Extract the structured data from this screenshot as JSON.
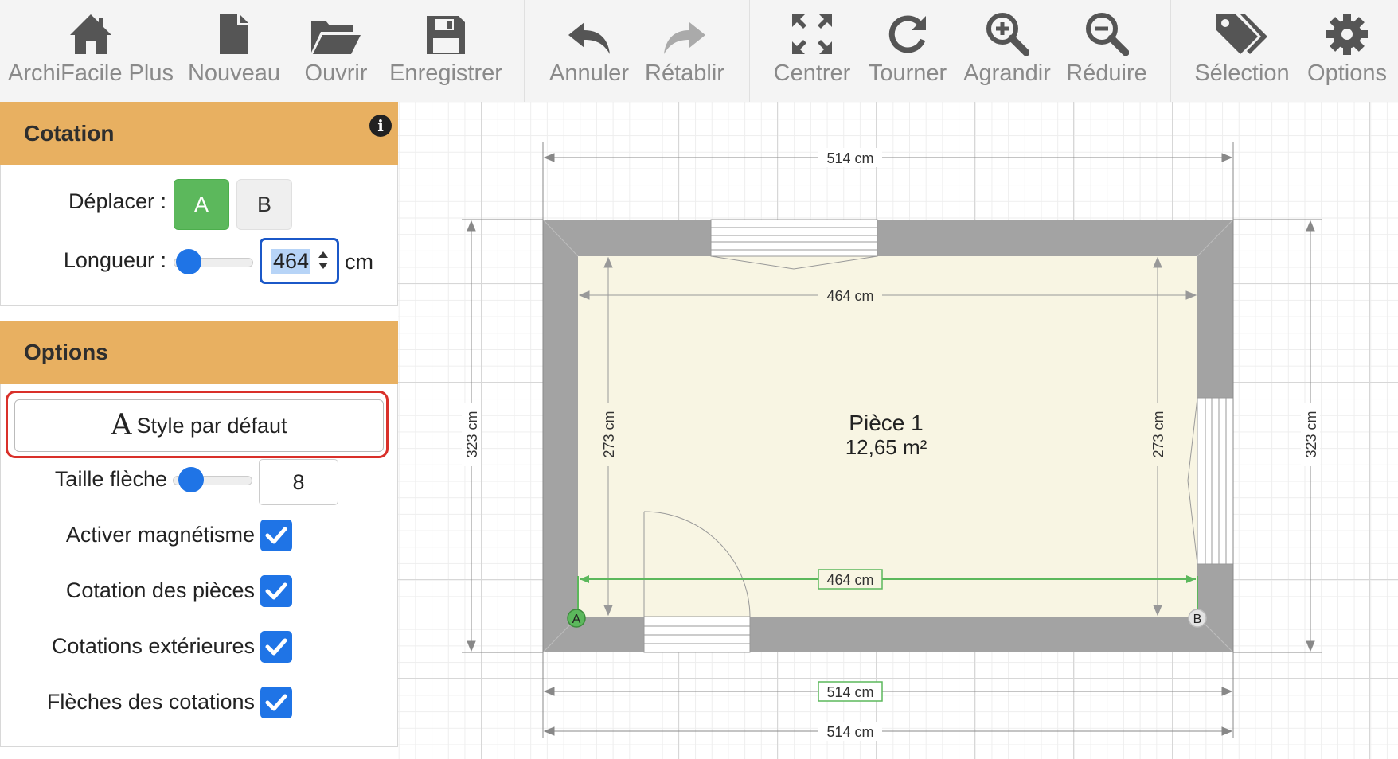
{
  "toolbar": {
    "home": "ArchiFacile Plus",
    "new": "Nouveau",
    "open": "Ouvrir",
    "save": "Enregistrer",
    "undo": "Annuler",
    "redo": "Rétablir",
    "center": "Centrer",
    "rotate": "Tourner",
    "zoom_in": "Agrandir",
    "zoom_out": "Réduire",
    "selection": "Sélection",
    "options": "Options"
  },
  "cotation_panel": {
    "title": "Cotation",
    "info_icon": "i",
    "move_label": "Déplacer :",
    "point_a": "A",
    "point_b": "B",
    "length_label": "Longueur :",
    "length_value": "464",
    "length_slider_fraction": 0.05,
    "length_unit": "cm"
  },
  "options_panel": {
    "title": "Options",
    "style_glyph": "A",
    "style_button": "Style par défaut",
    "arrow_size_label": "Taille flèche",
    "arrow_size_value": "8",
    "arrow_size_slider_fraction": 0.1,
    "checks": [
      {
        "label": "Activer magnétisme",
        "checked": true
      },
      {
        "label": "Cotation des pièces",
        "checked": true
      },
      {
        "label": "Cotations extérieures",
        "checked": true
      },
      {
        "label": "Flèches des cotations",
        "checked": true
      }
    ]
  },
  "plan": {
    "room_name": "Pièce 1",
    "room_area": "12,65 m²",
    "outer_width": "514 cm",
    "inner_width": "464 cm",
    "selected_dimension": "464 cm",
    "outer_height": "323 cm",
    "inner_height": "273 cm",
    "bottom_outer_1": "514 cm",
    "bottom_outer_2": "514 cm",
    "point_a": "A",
    "point_b": "B"
  },
  "colors": {
    "panel_header": "#e8b061",
    "accent_blue": "#1f74e6",
    "active_green": "#5cb85c",
    "highlight_red": "#d9302a",
    "wall_gray": "#a3a3a3",
    "floor": "#f8f5e3"
  }
}
